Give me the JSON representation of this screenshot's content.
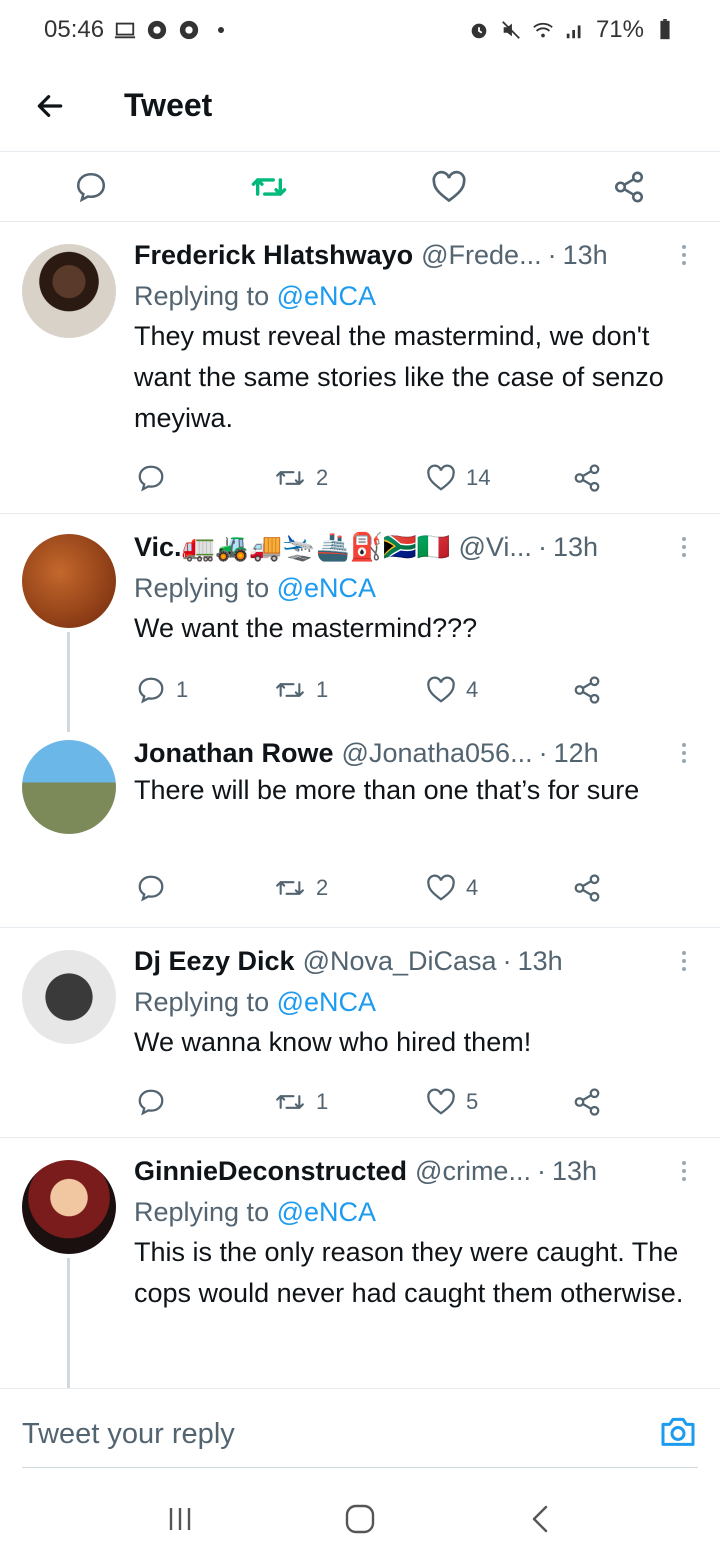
{
  "status_bar": {
    "time": "05:46",
    "battery": "71%"
  },
  "header": {
    "title": "Tweet"
  },
  "tweets": [
    {
      "name": "Frederick Hlatshwayo",
      "handle": "@Frede...",
      "time": "13h",
      "replying_prefix": "Replying to",
      "replying_to": "@eNCA",
      "text": "They must reveal the mastermind, we don't want the same stories like the case of senzo meyiwa.",
      "reply_count": "",
      "retweet_count": "2",
      "like_count": "14"
    },
    {
      "name": "Vic.🚛🚜🚚🛬🚢⛽🇿🇦🇮🇹",
      "handle": "@Vi...",
      "time": "13h",
      "replying_prefix": "Replying to",
      "replying_to": "@eNCA",
      "text": "We want the mastermind???",
      "reply_count": "1",
      "retweet_count": "1",
      "like_count": "4"
    },
    {
      "name": "Jonathan Rowe",
      "handle": "@Jonatha056...",
      "time": "12h",
      "text": "There will be more than one that’s for sure",
      "reply_count": "",
      "retweet_count": "2",
      "like_count": "4"
    },
    {
      "name": "Dj Eezy Dick",
      "handle": "@Nova_DiCasa",
      "time": "13h",
      "replying_prefix": "Replying to",
      "replying_to": "@eNCA",
      "text": "We wanna know who hired them!",
      "reply_count": "",
      "retweet_count": "1",
      "like_count": "5"
    },
    {
      "name": "GinnieDeconstructed",
      "handle": "@crime...",
      "time": "13h",
      "replying_prefix": "Replying to",
      "replying_to": "@eNCA",
      "text": "This is the only reason they were caught. The cops would never had caught them otherwise."
    }
  ],
  "reply_bar": {
    "placeholder": "Tweet your reply"
  },
  "colors": {
    "accent": "#1d9bf0",
    "retweet_active": "#00ba7c",
    "secondary_text": "#536471"
  }
}
